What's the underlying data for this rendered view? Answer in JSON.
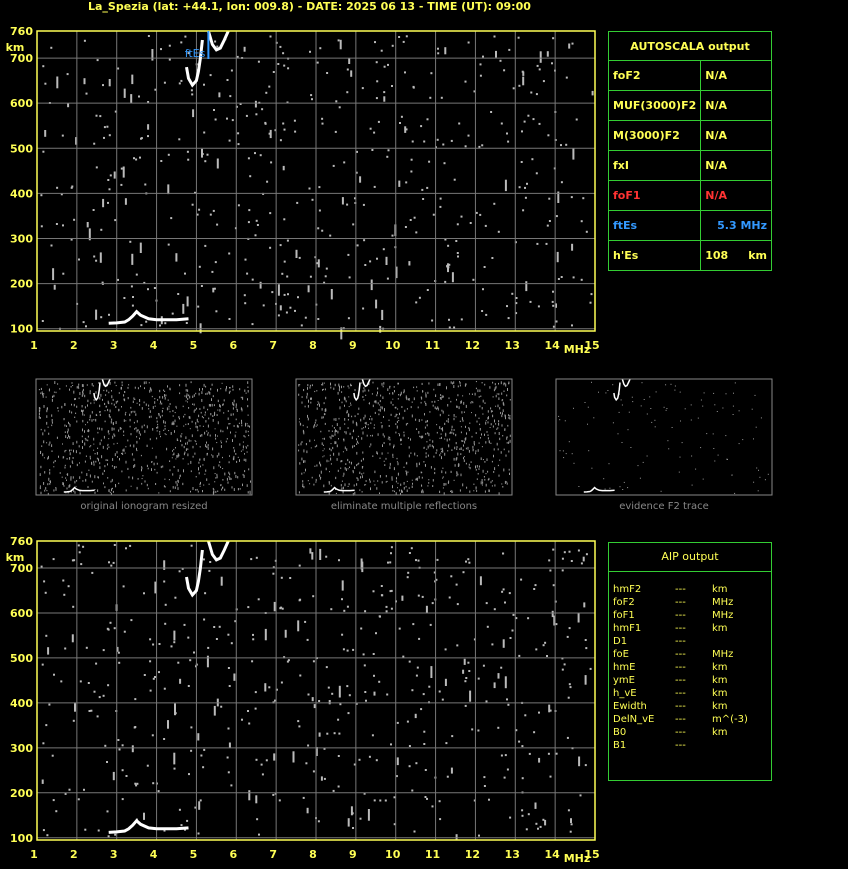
{
  "title": "La_Spezia (lat: +44.1, lon: 009.8) - DATE: 2025 06 13 - TIME (UT): 09:00",
  "colors": {
    "axis": "#ffff55",
    "grid": "#777777",
    "trace": "#ffffff",
    "noise": "#bbbbbb",
    "table_border": "#33cc33",
    "ftes": "#3399ff",
    "fof1": "#ff3333",
    "caption": "#888888"
  },
  "chart_data": [
    {
      "type": "scatter",
      "title": "",
      "xlabel": "MHz",
      "ylabel": "km",
      "xlim": [
        1,
        15
      ],
      "ylim": [
        95,
        760
      ],
      "x_ticks": [
        "1",
        "2",
        "3",
        "4",
        "5",
        "6",
        "7",
        "8",
        "9",
        "10",
        "11",
        "12",
        "13",
        "14",
        "15"
      ],
      "y_ticks": [
        "100",
        "200",
        "300",
        "400",
        "500",
        "600",
        "700",
        "760"
      ],
      "grid": true,
      "marker_label": "ftEs",
      "marker_x": 5.3,
      "traces": [
        {
          "name": "",
          "x": [
            2.8,
            3.0,
            3.2,
            3.3,
            3.4,
            3.5,
            3.6,
            3.8,
            4.0,
            4.2,
            4.5,
            4.8
          ],
          "y": [
            112,
            113,
            115,
            120,
            128,
            138,
            130,
            122,
            120,
            120,
            120,
            122
          ]
        },
        {
          "name": "",
          "x": [
            4.75,
            4.8,
            4.9,
            5.0,
            5.05,
            5.1,
            5.15
          ],
          "y": [
            680,
            655,
            640,
            650,
            670,
            700,
            740
          ]
        },
        {
          "name": "",
          "x": [
            5.3,
            5.4,
            5.5,
            5.6,
            5.7,
            5.8
          ],
          "y": [
            760,
            730,
            718,
            722,
            740,
            760
          ]
        }
      ]
    },
    {
      "type": "scatter",
      "title": "",
      "xlabel": "MHz",
      "ylabel": "km",
      "xlim": [
        1,
        15
      ],
      "ylim": [
        95,
        760
      ],
      "x_ticks": [
        "1",
        "2",
        "3",
        "4",
        "5",
        "6",
        "7",
        "8",
        "9",
        "10",
        "11",
        "12",
        "13",
        "14",
        "15"
      ],
      "y_ticks": [
        "100",
        "200",
        "300",
        "400",
        "500",
        "600",
        "700",
        "760"
      ],
      "grid": true,
      "traces": [
        {
          "name": "",
          "x": [
            2.8,
            3.0,
            3.2,
            3.3,
            3.4,
            3.5,
            3.6,
            3.8,
            4.0,
            4.2,
            4.5,
            4.8
          ],
          "y": [
            112,
            113,
            115,
            120,
            128,
            138,
            130,
            122,
            120,
            120,
            120,
            122
          ]
        },
        {
          "name": "",
          "x": [
            4.75,
            4.8,
            4.9,
            5.0,
            5.05,
            5.1,
            5.15
          ],
          "y": [
            680,
            655,
            640,
            650,
            670,
            700,
            740
          ]
        },
        {
          "name": "",
          "x": [
            5.3,
            5.4,
            5.5,
            5.6,
            5.7,
            5.8
          ],
          "y": [
            760,
            730,
            718,
            722,
            740,
            760
          ]
        }
      ]
    }
  ],
  "autoscala": {
    "header": "AUTOSCALA output",
    "rows": [
      {
        "label": "foF2",
        "value": "N/A",
        "unit": "",
        "color": "#ffff55"
      },
      {
        "label": "MUF(3000)F2",
        "value": "N/A",
        "unit": "",
        "color": "#ffff55"
      },
      {
        "label": "M(3000)F2",
        "value": "N/A",
        "unit": "",
        "color": "#ffff55"
      },
      {
        "label": "fxI",
        "value": "N/A",
        "unit": "",
        "color": "#ffff55"
      },
      {
        "label": "foF1",
        "value": "N/A",
        "unit": "",
        "color": "#ff3333"
      },
      {
        "label": "ftEs",
        "value": "5.3 MHz",
        "unit": "",
        "color": "#3399ff"
      },
      {
        "label": "h'Es",
        "value": "108",
        "unit": "km",
        "color": "#ffff55"
      }
    ]
  },
  "thumbnails": [
    {
      "caption": "original ionogram resized"
    },
    {
      "caption": "eliminate multiple reflections"
    },
    {
      "caption": "evidence F2 trace"
    }
  ],
  "aip": {
    "header": "AIP output",
    "rows": [
      {
        "label": "hmF2",
        "value": "---",
        "unit": "km"
      },
      {
        "label": "foF2",
        "value": "---",
        "unit": "MHz"
      },
      {
        "label": "foF1",
        "value": "---",
        "unit": "MHz"
      },
      {
        "label": "hmF1",
        "value": "---",
        "unit": "km"
      },
      {
        "label": "D1",
        "value": "---",
        "unit": ""
      },
      {
        "label": "foE",
        "value": "---",
        "unit": "MHz"
      },
      {
        "label": "hmE",
        "value": "---",
        "unit": "km"
      },
      {
        "label": "ymE",
        "value": "---",
        "unit": "km"
      },
      {
        "label": "h_vE",
        "value": "---",
        "unit": "km"
      },
      {
        "label": "Ewidth",
        "value": "---",
        "unit": "km"
      },
      {
        "label": "DelN_vE",
        "value": "---",
        "unit": "m^(-3)"
      },
      {
        "label": "B0",
        "value": "---",
        "unit": "km"
      },
      {
        "label": "B1",
        "value": "---",
        "unit": ""
      }
    ]
  }
}
